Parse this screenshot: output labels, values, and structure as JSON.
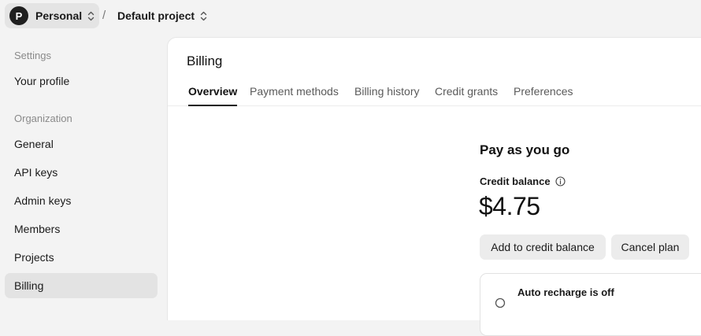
{
  "header": {
    "org": {
      "initial": "P",
      "name": "Personal"
    },
    "separator": "/",
    "project": {
      "name": "Default project"
    }
  },
  "sidebar": {
    "sections": [
      {
        "label": "Settings",
        "items": [
          {
            "label": "Your profile",
            "active": false
          }
        ]
      },
      {
        "label": "Organization",
        "items": [
          {
            "label": "General",
            "active": false
          },
          {
            "label": "API keys",
            "active": false
          },
          {
            "label": "Admin keys",
            "active": false
          },
          {
            "label": "Members",
            "active": false
          },
          {
            "label": "Projects",
            "active": false
          },
          {
            "label": "Billing",
            "active": true
          }
        ]
      }
    ]
  },
  "main": {
    "title": "Billing",
    "tabs": [
      {
        "label": "Overview",
        "active": true
      },
      {
        "label": "Payment methods",
        "active": false
      },
      {
        "label": "Billing history",
        "active": false
      },
      {
        "label": "Credit grants",
        "active": false
      },
      {
        "label": "Preferences",
        "active": false
      }
    ],
    "plan": {
      "title": "Pay as you go",
      "credit_label": "Credit balance",
      "balance": "$4.75",
      "add_button": "Add to credit balance",
      "cancel_button": "Cancel plan"
    },
    "auto_recharge": {
      "title": "Auto recharge is off"
    }
  },
  "icons": {
    "org_chevron": "chevron-up-down-icon",
    "project_chevron": "chevron-up-down-icon",
    "credit_info": "info-icon"
  },
  "colors": {
    "sidebar_bg": "#f3f3f3",
    "active_item_bg": "#e3e3e3",
    "main_bg": "#ffffff",
    "button_bg": "#ececec"
  }
}
